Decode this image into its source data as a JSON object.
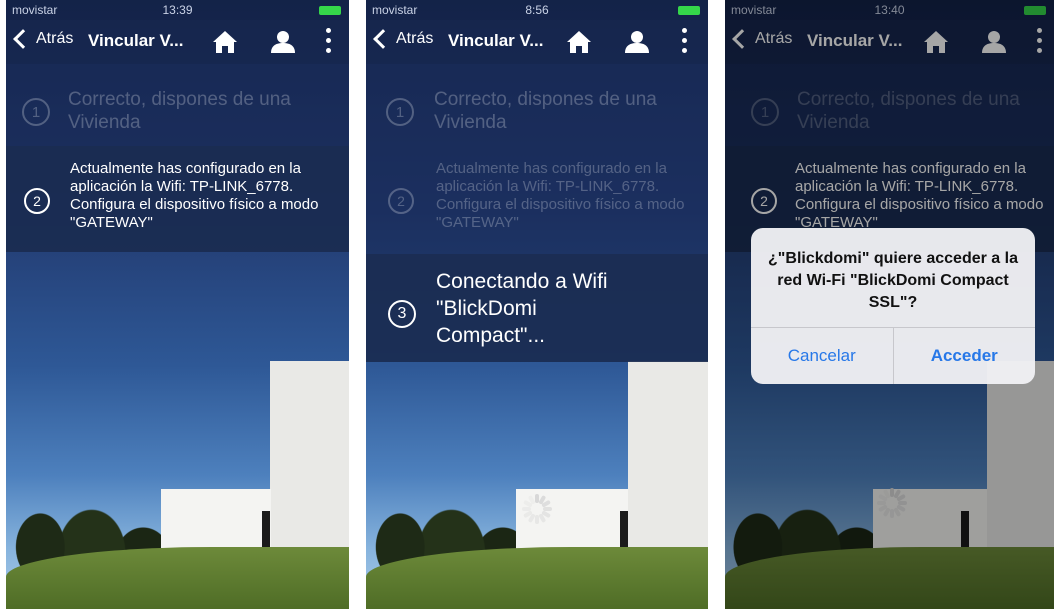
{
  "screens": [
    {
      "status": {
        "carrier": "movistar",
        "time": "13:39"
      },
      "nav": {
        "back": "Atrás",
        "title": "Vincular V..."
      },
      "steps": [
        {
          "number": "1",
          "text": "Correcto, dispones de una Vivienda"
        },
        {
          "number": "2",
          "text": "Actualmente has configurado en la aplicación la Wifi: TP-LINK_6778. Configura el dispositivo físico a modo \"GATEWAY\""
        }
      ]
    },
    {
      "status": {
        "carrier": "movistar",
        "time": "8:56"
      },
      "nav": {
        "back": "Atrás",
        "title": "Vincular V..."
      },
      "steps": [
        {
          "number": "1",
          "text": "Correcto, dispones de una Vivienda"
        },
        {
          "number": "2",
          "text": "Actualmente has configurado en la aplicación la Wifi: TP-LINK_6778. Configura el dispositivo físico a modo \"GATEWAY\""
        },
        {
          "number": "3",
          "text": "Conectando a Wifi \"BlickDomi Compact\"..."
        }
      ]
    },
    {
      "status": {
        "carrier": "movistar",
        "time": "13:40"
      },
      "nav": {
        "back": "Atrás",
        "title": "Vincular V..."
      },
      "steps": [
        {
          "number": "1",
          "text": "Correcto, dispones de una Vivienda"
        },
        {
          "number": "2",
          "text": "Actualmente has configurado en la aplicación la Wifi: TP-LINK_6778. Configura el dispositivo físico a modo \"GATEWAY\""
        }
      ],
      "dialog": {
        "message": "¿\"Blickdomi\" quiere acceder a la red Wi-Fi \"BlickDomi Compact SSL\"?",
        "cancel": "Cancelar",
        "accept": "Acceder"
      }
    }
  ],
  "icons": [
    "signal-icon",
    "wifi-icon",
    "battery-icon",
    "back-chevron-icon",
    "home-icon",
    "user-icon",
    "more-vertical-icon",
    "loading-spinner-icon"
  ],
  "colors": {
    "nav_bg": "#12204a",
    "active_step_bg": "#1a2b50",
    "battery": "#35d64a",
    "dialog_button": "#2778e8"
  }
}
